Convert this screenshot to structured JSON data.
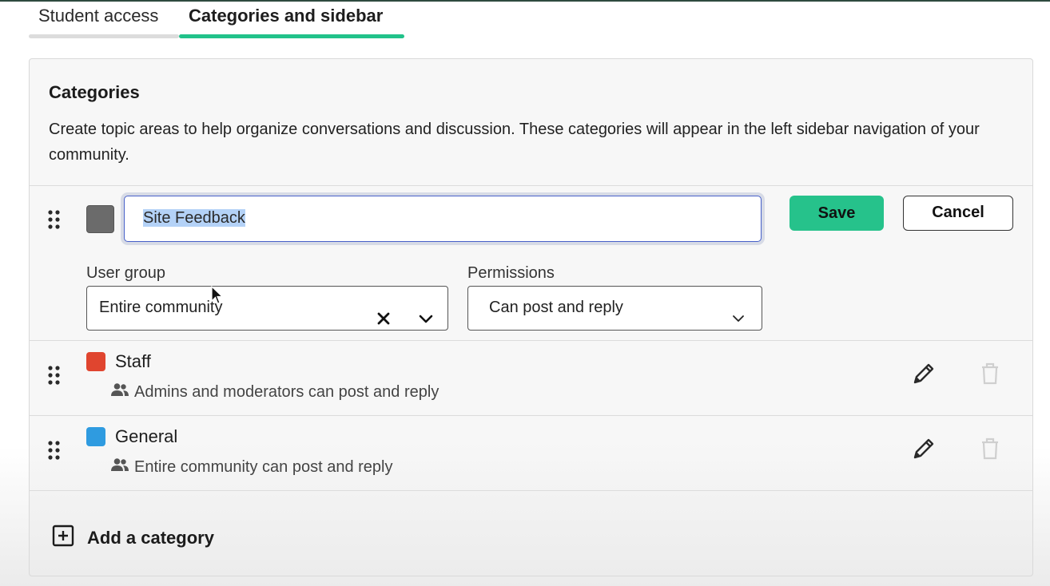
{
  "tabs": [
    {
      "label": "Student access",
      "active": false
    },
    {
      "label": "Categories and sidebar",
      "active": true
    }
  ],
  "panel": {
    "title": "Categories",
    "description": "Create topic areas to help organize conversations and discussion. These categories will appear in the left sidebar navigation of your community."
  },
  "editing": {
    "color": "#6b6b6b",
    "name_value": "Site Feedback",
    "save_label": "Save",
    "cancel_label": "Cancel",
    "user_group_label": "User group",
    "user_group_value": "Entire community",
    "permissions_label": "Permissions",
    "permissions_value": "Can post and reply"
  },
  "categories": [
    {
      "name": "Staff",
      "color": "#e0452f",
      "permission": "Admins and moderators can post and reply"
    },
    {
      "name": "General",
      "color": "#2f9be0",
      "permission": "Entire community can post and reply"
    }
  ],
  "add_label": "Add a category",
  "colors": {
    "accent": "#26c28b",
    "focus": "#4861c9"
  },
  "icons": [
    "drag-handle-icon",
    "close-icon",
    "chevron-down-icon",
    "users-icon",
    "pencil-icon",
    "trash-icon",
    "plus-square-icon"
  ]
}
